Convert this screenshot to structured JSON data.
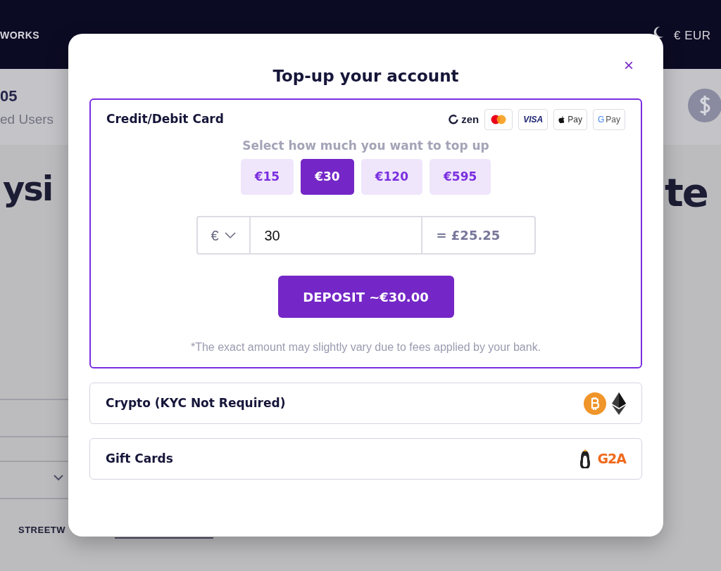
{
  "background": {
    "nav_items": [
      "WORKS"
    ],
    "currency": "€ EUR",
    "stat_value": "05",
    "stat_label": "ed Users",
    "headline_left": "ysi",
    "headline_right": "te",
    "footer_label": "STREETW"
  },
  "modal": {
    "title": "Top-up your account",
    "close": "×",
    "methods": [
      {
        "kind": "card",
        "label": "Credit/Debit Card",
        "expanded": true,
        "logos": [
          {
            "kind": "zen",
            "label": "zen"
          },
          {
            "kind": "mastercard"
          },
          {
            "kind": "visa",
            "label": "VISA"
          },
          {
            "kind": "applepay",
            "label": "Pay"
          },
          {
            "kind": "googlepay",
            "mark": "G",
            "label": "Pay"
          }
        ]
      },
      {
        "kind": "crypto",
        "label": "Crypto (KYC Not Required)",
        "expanded": false,
        "logos": [
          {
            "kind": "bitcoin"
          },
          {
            "kind": "ethereum"
          }
        ]
      },
      {
        "kind": "giftcard",
        "label": "Gift Cards",
        "expanded": false,
        "logos": [
          {
            "kind": "penguin"
          },
          {
            "kind": "g2a",
            "label": "G2A"
          }
        ]
      }
    ],
    "prompt": "Select how much you want to top up",
    "amounts": [
      {
        "label": "€15",
        "selected": false
      },
      {
        "label": "€30",
        "selected": true
      },
      {
        "label": "€120",
        "selected": false
      },
      {
        "label": "€595",
        "selected": false
      }
    ],
    "currency_symbol": "€",
    "amount_value": "30",
    "converted": "= £25.25",
    "deposit_button": "DEPOSIT ~€30.00",
    "note": "*The exact amount may slightly vary due to fees applied by your bank."
  }
}
